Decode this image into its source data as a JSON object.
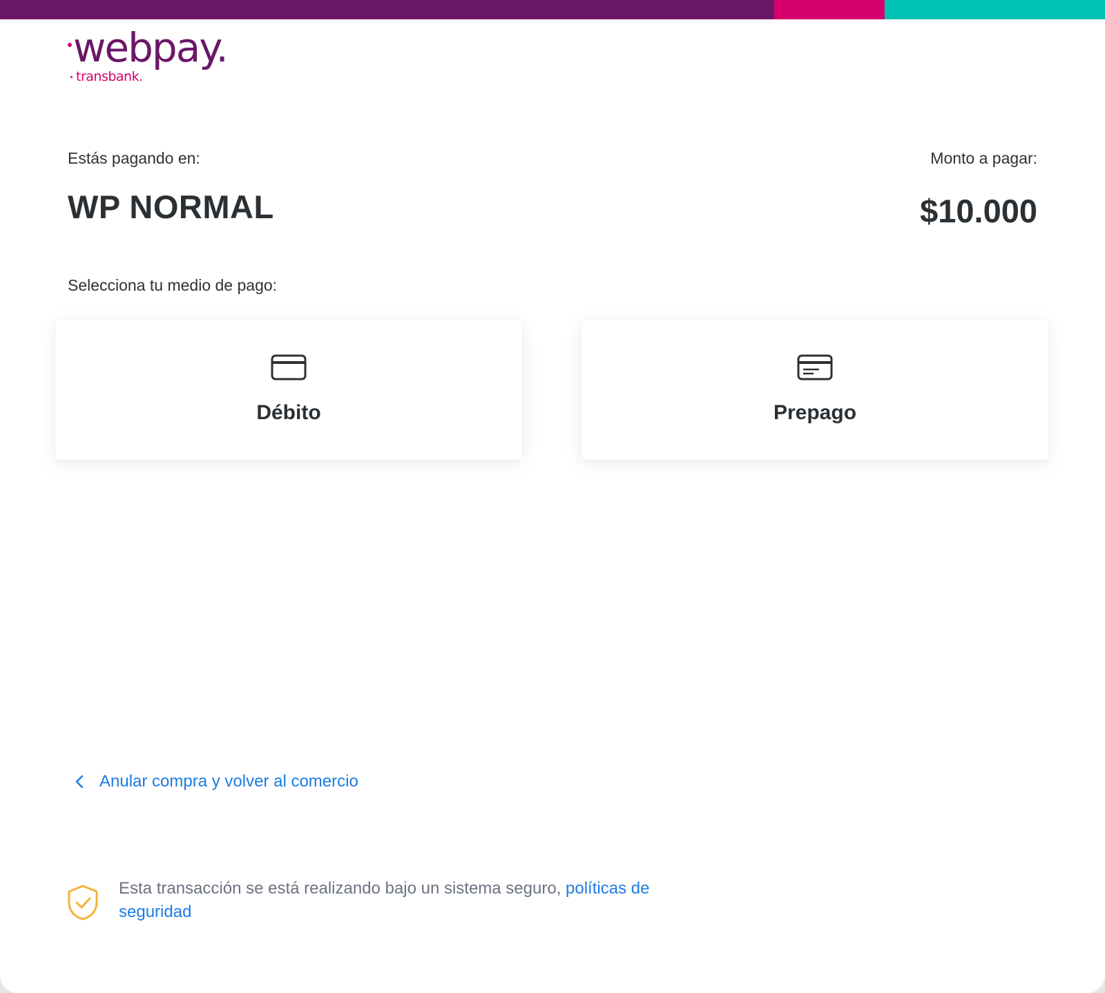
{
  "colors": {
    "bar_purple": "#6a1768",
    "bar_pink": "#d6006d",
    "bar_teal": "#00c2b3",
    "logo_purple": "#6a1768",
    "logo_pink": "#d6006d",
    "link_blue": "#1c7ce3",
    "shield_yellow": "#f5b335"
  },
  "logo": {
    "brand": "webpay.",
    "sub": "transbank."
  },
  "merchant": {
    "label": "Estás pagando en:",
    "name": "WP NORMAL"
  },
  "amount": {
    "label": "Monto a pagar:",
    "value": "$10.000"
  },
  "payment": {
    "prompt": "Selecciona tu medio de pago:",
    "options": [
      {
        "label": "Débito",
        "icon": "credit-card-icon"
      },
      {
        "label": "Prepago",
        "icon": "prepaid-card-icon"
      }
    ]
  },
  "cancel": {
    "icon": "chevron-left-icon",
    "label": "Anular compra y volver al comercio"
  },
  "security": {
    "icon": "shield-check-icon",
    "text": "Esta transacción se está realizando bajo un sistema seguro, ",
    "link": "políticas de seguridad"
  }
}
